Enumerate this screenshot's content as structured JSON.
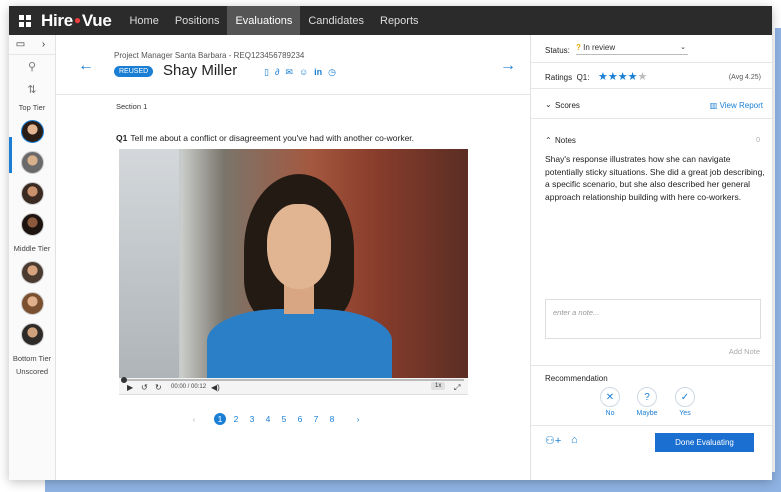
{
  "app": {
    "logo": "Hire",
    "logo_dot": "●",
    "logo_suffix": "Vue"
  },
  "nav": [
    {
      "label": "Home"
    },
    {
      "label": "Positions"
    },
    {
      "label": "Evaluations"
    },
    {
      "label": "Candidates"
    },
    {
      "label": "Reports"
    }
  ],
  "rail": {
    "top_tier": "Top Tier",
    "middle_tier": "Middle Tier",
    "bottom_tier": "Bottom Tier",
    "unscored": "Unscored"
  },
  "candidate": {
    "breadcrumb": "Project Manager Santa Barbara - REQ123456789234",
    "badge": "REUSED",
    "name": "Shay Miller"
  },
  "section": "Section 1",
  "question": {
    "num": "Q1",
    "text": "Tell me about a conflict or disagreement you've had with another co-worker."
  },
  "video": {
    "time": "00:00 / 00:12",
    "speed": "1x",
    "progress": 0.0
  },
  "pager": {
    "pages": [
      "1",
      "2",
      "3",
      "4",
      "5",
      "6",
      "7",
      "8"
    ],
    "current": "1"
  },
  "status": {
    "label": "Status:",
    "value": "In review"
  },
  "ratings": {
    "label": "Ratings",
    "q": "Q1:",
    "value": 4,
    "max": 5,
    "avg": "(Avg 4.25)"
  },
  "scores": {
    "label": "Scores",
    "view_report": "View Report"
  },
  "notes": {
    "label": "Notes",
    "count": "0",
    "text": "Shay's response illustrates how she can navigate potentially sticky situations. She did a great job describing, a specific scenario, but she also described her general approach relationship building with here co-workers.",
    "placeholder": "enter a note...",
    "add": "Add Note"
  },
  "recommendation": {
    "label": "Recommendation",
    "no": "No",
    "maybe": "Maybe",
    "yes": "Yes"
  },
  "done": "Done Evaluating",
  "colors": {
    "accent": "#1a7fd4",
    "topbar": "#2b2b2b",
    "logo_dot": "#e8403f"
  }
}
